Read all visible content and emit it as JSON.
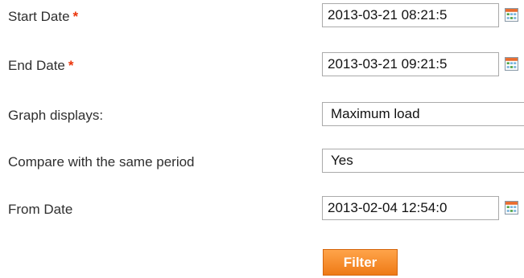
{
  "filters": {
    "start_date": {
      "label": "Start Date",
      "required_mark": "*",
      "value": "2013-03-21 08:21:5"
    },
    "end_date": {
      "label": "End Date",
      "required_mark": "*",
      "value": "2013-03-21 09:21:5"
    },
    "graph_displays": {
      "label": "Graph displays:",
      "value": "Maximum load"
    },
    "compare": {
      "label": "Compare with the same period",
      "value": "Yes"
    },
    "from_date": {
      "label": "From Date",
      "value": "2013-02-04 12:54:0"
    },
    "filter_button_label": "Filter"
  },
  "icons": {
    "calendar": "calendar-icon"
  },
  "colors": {
    "required": "#eb340a",
    "button": "#f08a24",
    "label": "#2f2f2f"
  }
}
